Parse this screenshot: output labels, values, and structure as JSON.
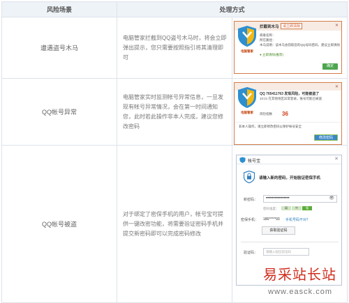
{
  "table": {
    "headers": {
      "scene": "风险场景",
      "method": "处理方式"
    },
    "rows": [
      {
        "scene": "遭遇盗号木马",
        "desc": "电脑管家拦截到QQ盗号木马时，将会立即弹出提示，您只需要按照指引将其清理即可"
      },
      {
        "scene": "QQ帐号异常",
        "desc": "电脑管家实时监测帐号异常信息，一旦发现有帐号异常情况，会在第一时间通知您，此时若此操作非本人完成，建议您修改密码"
      },
      {
        "scene": "QQ帐号被盗",
        "desc": "对于绑定了密保手机的用户，帐号宝可提供一键改密功能，将需要验证密码手机并提交新密码即可以完成密码修改"
      }
    ]
  },
  "popup1": {
    "brand": "电脑管家",
    "title": "拦截到木马",
    "tag": "请立即清除",
    "lines": [
      "病毒名称：",
      "所在路径：",
      "木马说明：该木马会窃取您的QQ号码密码，建议立即清除",
      "● 立即清除(推荐)"
    ],
    "button": "确定"
  },
  "popup2": {
    "brand": "电脑管家",
    "title": "QQ 765411763 发现风险，可能被盗了",
    "line": "10:21 在其他地区异常登录，账号可能已被盗",
    "risk_label": "风险指数",
    "danger_value": "36",
    "note": "非本人操作，请立即修改密码以保护帐号安全",
    "button": "修改密码"
  },
  "win": {
    "title": "帐号宝",
    "heading": "请输入新的密码，开始验证密保手机",
    "new_password_label": "新密码：",
    "password_dots": "••••••••••••••••",
    "strength_label": "密码强度：",
    "strength_levels": [
      "弱",
      "中",
      "强"
    ],
    "phone_label": "密保手机：",
    "phone_value": "186*****93",
    "phone_link": "手机号码不对？",
    "get_code_button": "获取验证码",
    "code_label": "验证码：",
    "code_placeholder": "请输入短信验证码"
  },
  "watermark": {
    "text": "易采站长站",
    "url": "www.easck.com"
  },
  "colors": {
    "header_bg": "#eef3f8",
    "border": "#dde3ea",
    "accent_red": "#d02c1c",
    "popup_border": "#d37c48"
  }
}
